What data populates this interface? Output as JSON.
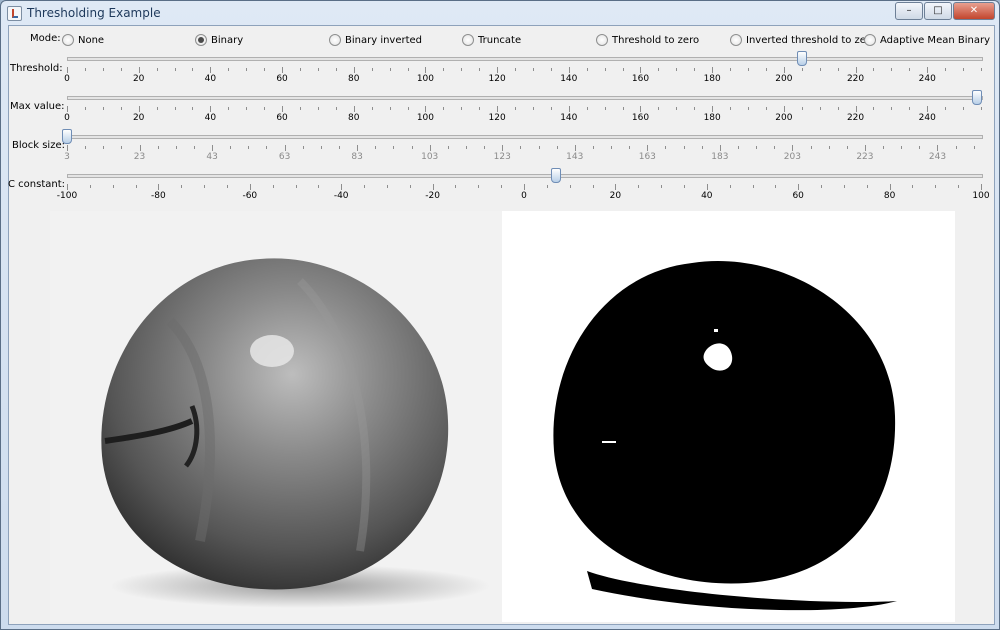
{
  "window": {
    "title": "Thresholding Example",
    "buttons": {
      "minimize": "–",
      "maximize": "□",
      "close": "✕"
    }
  },
  "mode": {
    "label": "Mode:",
    "options": [
      "None",
      "Binary",
      "Binary inverted",
      "Truncate",
      "Threshold to zero",
      "Inverted threshold to zero",
      "Adaptive Mean Binary"
    ],
    "selected": "Binary"
  },
  "sliders": {
    "threshold": {
      "label": "Threshold:",
      "value": 205,
      "min": 0,
      "max": 255,
      "tick_labels": [
        "0",
        "20",
        "40",
        "60",
        "80",
        "100",
        "120",
        "140",
        "160",
        "180",
        "200",
        "220",
        "240"
      ],
      "enabled": true
    },
    "max_value": {
      "label": "Max value:",
      "value": 255,
      "min": 0,
      "max": 255,
      "tick_labels": [
        "0",
        "20",
        "40",
        "60",
        "80",
        "100",
        "120",
        "140",
        "160",
        "180",
        "200",
        "220",
        "240"
      ],
      "enabled": true
    },
    "block_size": {
      "label": "Block size:",
      "value": 3,
      "min": 3,
      "max": 255,
      "tick_labels": [
        "3",
        "23",
        "43",
        "63",
        "83",
        "103",
        "123",
        "143",
        "163",
        "183",
        "203",
        "223",
        "243"
      ],
      "enabled": false
    },
    "c_constant": {
      "label": "C constant:",
      "value": 7,
      "min": -100,
      "max": 100,
      "tick_labels": [
        "-100",
        "-80",
        "-60",
        "-40",
        "-20",
        "0",
        "20",
        "40",
        "60",
        "80",
        "100"
      ],
      "enabled": true
    }
  },
  "images": {
    "left": "grayscale-apple-image",
    "right": "binary-thresholded-apple-image"
  }
}
